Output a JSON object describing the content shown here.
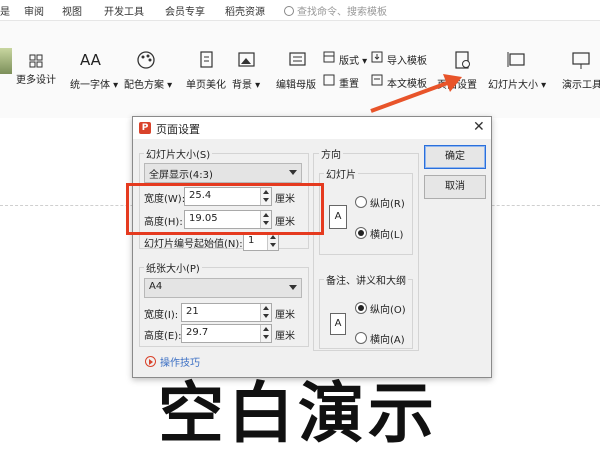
{
  "menu": {
    "items": [
      "审阅",
      "视图",
      "开发工具",
      "会员专享",
      "稻壳资源"
    ],
    "search_placeholder": "查找命令、搜索模板"
  },
  "toolbar": {
    "more_design": "更多设计",
    "unify_font": "统一字体",
    "color_scheme": "配色方案",
    "single_page": "单页美化",
    "background": "背景",
    "edit_master": "编辑母版",
    "layout": "版式",
    "reset": "重置",
    "import_template": "导入模板",
    "this_template": "本文模板",
    "page_setup": "页面设置",
    "slide_size": "幻灯片大小",
    "present_tools": "演示工具"
  },
  "slide": {
    "title": "空白演示"
  },
  "dialog": {
    "title": "页面设置",
    "slide_size_label": "幻灯片大小(S)",
    "slide_size_value": "全屏显示(4:3)",
    "width_label": "宽度(W):",
    "width_value": "25.4",
    "height_label": "高度(H):",
    "height_value": "19.05",
    "unit": "厘米",
    "start_number_label": "幻灯片编号起始值(N):",
    "start_number_value": "1",
    "paper_label": "纸张大小(P)",
    "paper_value": "A4",
    "paper_width_label": "宽度(I):",
    "paper_width_value": "21",
    "paper_height_label": "高度(E):",
    "paper_height_value": "29.7",
    "orientation_label": "方向",
    "slides_label": "幻灯片",
    "portrait": "纵向(R)",
    "landscape": "横向(L)",
    "notes_label": "备注、讲义和大纲",
    "notes_portrait": "纵向(O)",
    "notes_landscape": "横向(A)",
    "ok": "确定",
    "cancel": "取消",
    "tips": "操作技巧",
    "page_glyph": "A"
  },
  "colors": {
    "accent": "#2a6fdb",
    "highlight": "#e53a1f"
  }
}
